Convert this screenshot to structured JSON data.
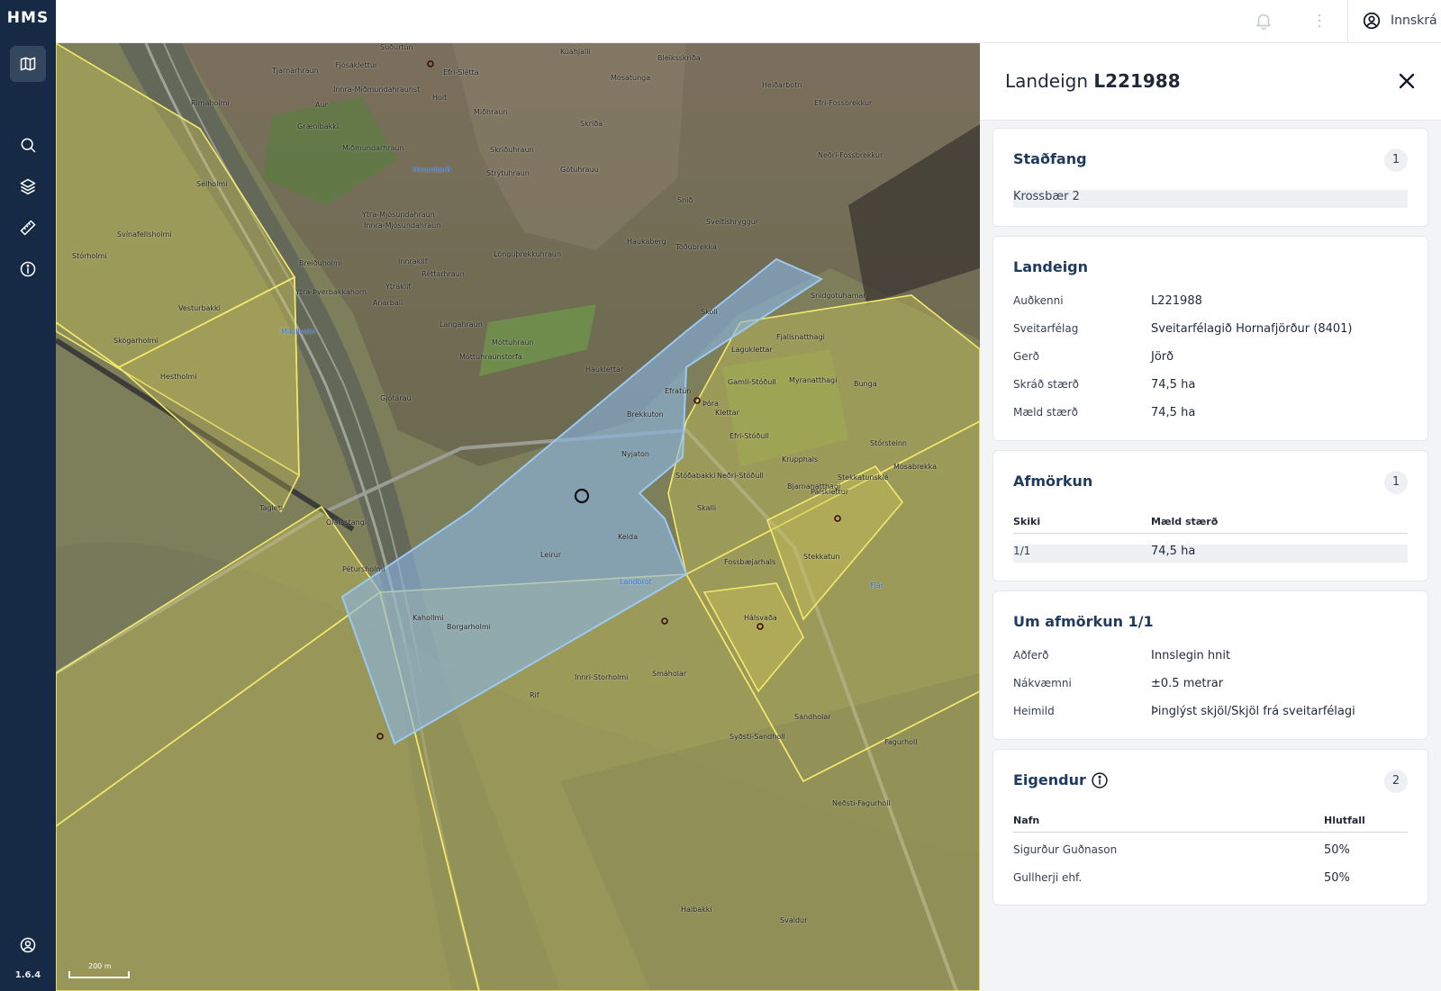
{
  "app": {
    "logo": "HMS",
    "version": "1.6.4"
  },
  "topbar": {
    "login_label": "Innskrá"
  },
  "panel": {
    "title_prefix": "Landeign",
    "title_id": "L221988",
    "stadfang": {
      "heading": "Staðfang",
      "count": "1",
      "address": "Krossbær 2"
    },
    "landeign": {
      "heading": "Landeign",
      "rows": [
        {
          "key": "Auðkenni",
          "value": "L221988"
        },
        {
          "key": "Sveitarfélag",
          "value": "Sveitarfélagið Hornafjörður (8401)"
        },
        {
          "key": "Gerð",
          "value": "Jörð"
        },
        {
          "key": "Skráð stærð",
          "value": "74,5 ha"
        },
        {
          "key": "Mæld stærð",
          "value": "74,5 ha"
        }
      ]
    },
    "afmorkun": {
      "heading": "Afmörkun",
      "count": "1",
      "col1": "Skiki",
      "col2": "Mæld stærð",
      "row": {
        "skiki": "1/1",
        "size": "74,5 ha"
      }
    },
    "um_afmorkun": {
      "heading": "Um afmörkun 1/1",
      "rows": [
        {
          "key": "Aðferð",
          "value": "Innslegin hnit"
        },
        {
          "key": "Nákvæmni",
          "value": "±0.5 metrar"
        },
        {
          "key": "Heimild",
          "value": "Þinglýst skjöl/Skjöl frá sveitarfélagi"
        }
      ]
    },
    "eigendur": {
      "heading": "Eigendur",
      "count": "2",
      "col1": "Nafn",
      "col2": "Hlutfall",
      "rows": [
        {
          "name": "Sigurður Guðnason",
          "share": "50%"
        },
        {
          "name": "Gullherji ehf.",
          "share": "50%"
        }
      ]
    }
  },
  "map": {
    "scale_label": "200 m",
    "labels": [
      "Suðurtún",
      "Tjarnarhraun",
      "Fjósaklettur",
      "Efri-Slétta",
      "Kúahjalli",
      "Bleiksskriða",
      "Mosatunga",
      "Heiðarbotn",
      "Rimaholmi",
      "Innra-Miðmundahraunst",
      "Holt",
      "Aur",
      "Miðhraun",
      "Efri-Fossbrekkur",
      "Skriða",
      "Græníbakki",
      "Miðmundarhraun",
      "Skriðuhraun",
      "Neðri-Fossbrekkur",
      "Götuhrauu",
      "Strýtuhraun",
      "Snið",
      "Sveltishryggur",
      "Ytra-Mjósundahraun",
      "Innra-Mjósundahraun",
      "Haukaberg",
      "Töðubrekka",
      "Lönguþrekkuhraun",
      "Breiðuholmi",
      "Innraklif",
      "Réttarhraun",
      "Ytra-Þverbakkahorn",
      "Ytraklif",
      "Anarbali",
      "Langahraun",
      "Móttuhraun",
      "Móttuhraunstorfa",
      "Hauklettar",
      "Gjótárau",
      "Fjallsnatthagi",
      "Laguklettar",
      "Myranatthagi",
      "Bunga",
      "Efri-Stóðull",
      "Krupphals",
      "Stórsteinn",
      "Mosabrekka",
      "Bjarnanatthagi",
      "Stekkatunsklé",
      "Pálsklettur",
      "Ólafsstangi",
      "Pétursholmi",
      "Fossbæjarhals",
      "Stekkatun",
      "Hálsvaða",
      "Smáholar",
      "Sandholar",
      "Innri-Storholmi",
      "Rif",
      "Syðsti-Sandholl",
      "Neðsti-Fagurholl",
      "Fagurholl",
      "Haibakki",
      "Svaldur",
      "Vesturbakki",
      "Skógarholmi",
      "Hestholmi",
      "Svínafellsholmi",
      "Tagleti",
      "Stórholmi",
      "Selholmi",
      "Kahollmi",
      "Borgarholmi",
      "Nyjaton",
      "Brekkuton",
      "Efratún",
      "Neðri-Stóðull",
      "Stóðabakki",
      "Skalli",
      "Kelda",
      "Klettar",
      "Snidgotuhamar",
      "Landbrot",
      "Hraunbarð",
      "Mikillvatn",
      "Fjár",
      "Skóli",
      "Leirur",
      "Þóra",
      "Gamli-Stóðull"
    ]
  }
}
